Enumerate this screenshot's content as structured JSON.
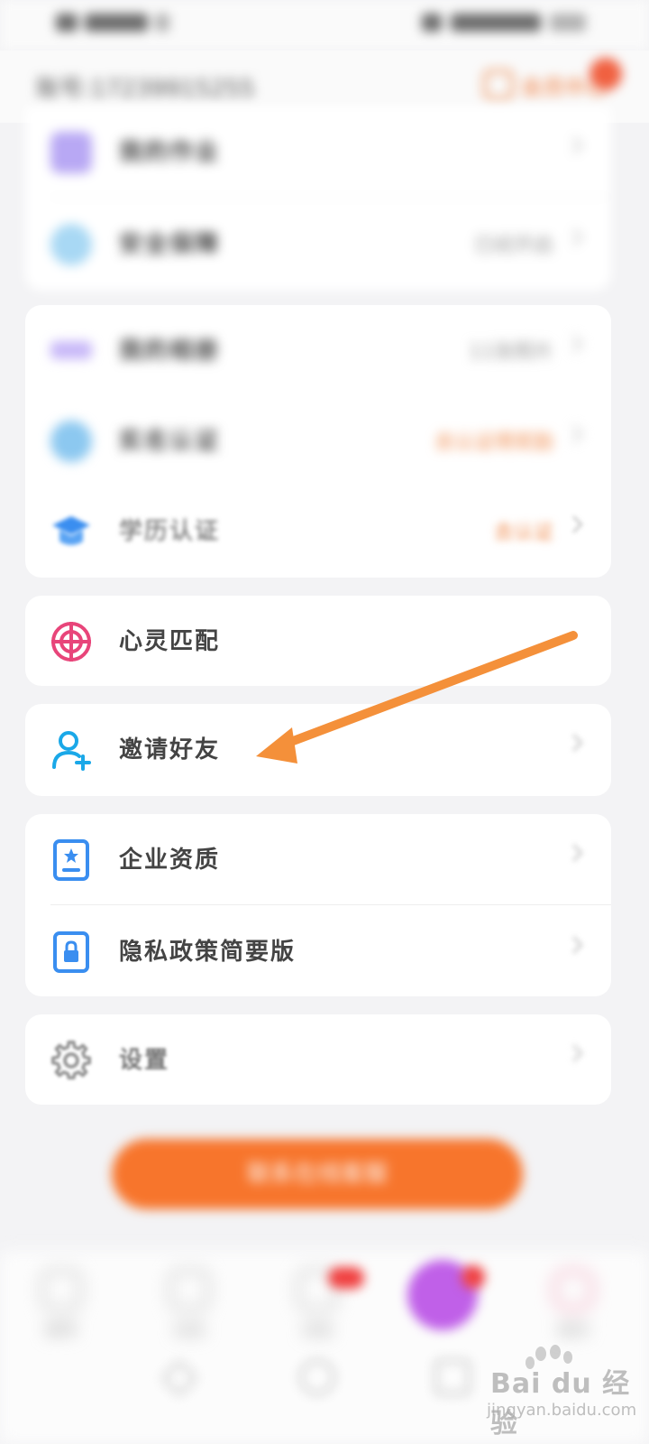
{
  "header": {
    "account_id": "账号:17239915255",
    "badge_label": "会员中心"
  },
  "section_top": {
    "items": [
      {
        "label": "我的作业",
        "value": ""
      },
      {
        "label": "安全保障",
        "value": "已经开启"
      }
    ]
  },
  "section_auth": {
    "items": [
      {
        "label": "我的相册",
        "value": "11张照片"
      },
      {
        "label": "实名认证",
        "value": "去认证得奖励"
      },
      {
        "label": "学历认证",
        "value": "去认证"
      }
    ]
  },
  "match": {
    "label": "心灵匹配"
  },
  "invite": {
    "label": "邀请好友"
  },
  "company": {
    "items": [
      {
        "label": "企业资质"
      },
      {
        "label": "隐私政策简要版"
      }
    ]
  },
  "settings": {
    "label": "设置"
  },
  "primary_button": {
    "label": "联系在线客服"
  },
  "tabbar": {
    "tabs": [
      {
        "label": "推荐"
      },
      {
        "label": "动态"
      },
      {
        "label": "消息"
      },
      {
        "label": ""
      },
      {
        "label": "我的"
      }
    ]
  },
  "watermark": {
    "brand": "Bai du 经验",
    "url": "jingyan.baidu.com"
  },
  "colors": {
    "accent": "#f7752c",
    "arrow": "#f4903a",
    "invite_icon": "#1aa8e8"
  }
}
